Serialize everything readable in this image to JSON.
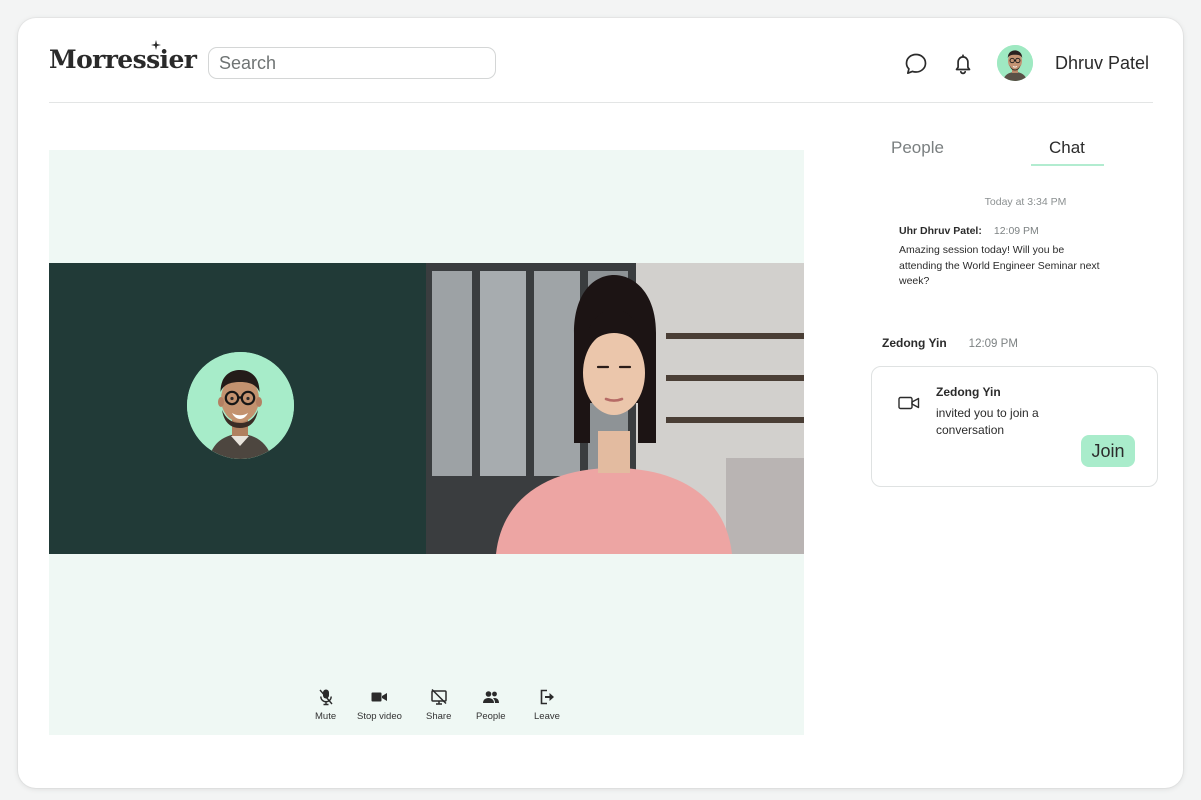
{
  "header": {
    "logo_text": "Morressier",
    "search": {
      "placeholder": "Search",
      "value": ""
    },
    "user_name": "Dhruv Patel"
  },
  "controls": [
    {
      "label": "Mute",
      "icon": "mic-off-icon"
    },
    {
      "label": "Stop video",
      "icon": "video-icon"
    },
    {
      "label": "Share",
      "icon": "screen-share-off-icon"
    },
    {
      "label": "People",
      "icon": "people-icon"
    },
    {
      "label": "Leave",
      "icon": "leave-icon"
    }
  ],
  "panel": {
    "tabs": [
      {
        "label": "People",
        "active": false
      },
      {
        "label": "Chat",
        "active": true
      }
    ],
    "chat_date": "Today at 3:34 PM",
    "message": {
      "sender": "Uhr Dhruv Patel:",
      "time": "12:09 PM",
      "text": "Amazing session today! Will you be attending the World Engineer Seminar next week?"
    },
    "system_line": {
      "name": "Zedong Yin",
      "time": "12:09 PM"
    },
    "invite": {
      "name": "Zedong Yin",
      "text": "invited you to join a conversation",
      "button_label": "Join"
    }
  },
  "colors": {
    "accent": "#a9eccb",
    "stage_background": "#eff8f4",
    "tile_dark": "#213a37"
  }
}
